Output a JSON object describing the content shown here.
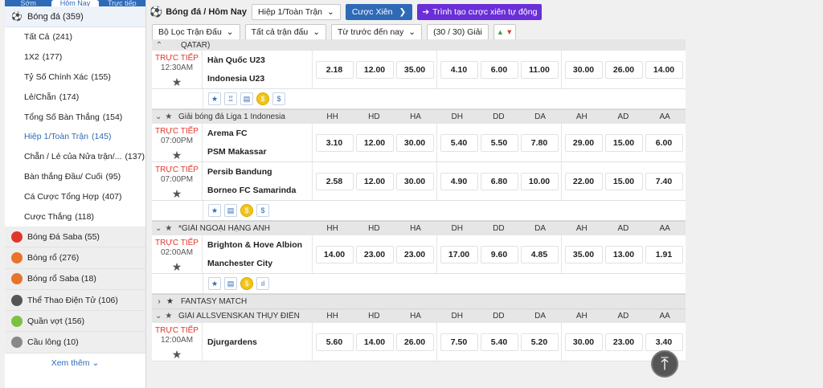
{
  "sidebar": {
    "tabs": [
      "Sớm",
      "Hôm Nay",
      "Trực tiếp"
    ],
    "football": {
      "label": "Bóng đá",
      "count": "(359)"
    },
    "items": [
      {
        "label": "Tất Cả",
        "count": "(241)"
      },
      {
        "label": "1X2",
        "count": "(177)"
      },
      {
        "label": "Tỷ Số Chính Xác",
        "count": "(155)"
      },
      {
        "label": "Lẻ/Chẵn",
        "count": "(174)"
      },
      {
        "label": "Tổng Số Bàn Thắng",
        "count": "(154)"
      },
      {
        "label": "Hiệp 1/Toàn Trận",
        "count": "(145)"
      },
      {
        "label": "Chẵn / Lẻ của Nửa trận/...",
        "count": "(137)"
      },
      {
        "label": "Bàn thắng Đầu/ Cuối",
        "count": "(95)"
      },
      {
        "label": "Cá Cược Tổng Hợp",
        "count": "(407)"
      },
      {
        "label": "Cược Thắng",
        "count": "(118)"
      }
    ],
    "sports": [
      {
        "label": "Bóng Đá Saba",
        "count": "(55)",
        "icon": "soccer-ball-icon",
        "color": "#e0352b"
      },
      {
        "label": "Bóng rổ",
        "count": "(276)",
        "icon": "basketball-icon",
        "color": "#e8732a"
      },
      {
        "label": "Bóng rổ Saba",
        "count": "(18)",
        "icon": "basketball-icon",
        "color": "#e8732a"
      },
      {
        "label": "Thể Thao Điện Tử",
        "count": "(106)",
        "icon": "headset-icon",
        "color": "#555555"
      },
      {
        "label": "Quần vợt",
        "count": "(156)",
        "icon": "tennis-ball-icon",
        "color": "#7cc242"
      },
      {
        "label": "Cầu lông",
        "count": "(10)",
        "icon": "shuttlecock-icon",
        "color": "#888888"
      }
    ],
    "more": "Xem thêm"
  },
  "topbar": {
    "title": "Bóng đá / Hôm Nay",
    "period": "Hiệp 1/Toàn Trận",
    "parlay": "Cược Xiên",
    "auto_builder": "Trình tạo cược xiên tự động"
  },
  "filters": {
    "league_filter": "Bộ Lọc Trận Đấu",
    "all_matches": "Tất cả trận đấu",
    "sort": "Từ trước đến nay",
    "leagues": "(30 / 30) Giải"
  },
  "columns": [
    "HH",
    "HD",
    "HA",
    "DH",
    "DD",
    "DA",
    "AH",
    "AD",
    "AA"
  ],
  "first_league": "QATAR)",
  "leagues": [
    {
      "name": "",
      "matches": [
        {
          "status": "TRỰC TIẾP",
          "time": "12:30AM",
          "home": "Hàn Quốc U23",
          "away": "Indonesia U23",
          "odds": [
            "2.18",
            "12.00",
            "35.00",
            "4.10",
            "6.00",
            "11.00",
            "30.00",
            "26.00",
            "14.00"
          ]
        }
      ]
    },
    {
      "name": "Giải bóng đá Liga 1 Indonesia",
      "matches": [
        {
          "status": "TRỰC TIẾP",
          "time": "07:00PM",
          "home": "Arema FC",
          "away": "PSM Makassar",
          "odds": [
            "3.10",
            "12.00",
            "30.00",
            "5.40",
            "5.50",
            "7.80",
            "29.00",
            "15.00",
            "6.00"
          ]
        },
        {
          "status": "TRỰC TIẾP",
          "time": "07:00PM",
          "home": "Persib Bandung",
          "away": "Borneo FC Samarinda",
          "odds": [
            "2.58",
            "12.00",
            "30.00",
            "4.90",
            "6.80",
            "10.00",
            "22.00",
            "15.00",
            "7.40"
          ]
        }
      ]
    },
    {
      "name": "*GIẢI NGOẠI HẠNG ANH",
      "matches": [
        {
          "status": "TRỰC TIẾP",
          "time": "02:00AM",
          "home": "Brighton & Hove Albion",
          "away": "Manchester City",
          "odds": [
            "14.00",
            "23.00",
            "23.00",
            "17.00",
            "9.60",
            "4.85",
            "35.00",
            "13.00",
            "1.91"
          ]
        }
      ]
    }
  ],
  "fantasy": "FANTASY MATCH",
  "last_league": {
    "name": "GIẢI ALLSVENSKAN THỤY ĐIỂN",
    "match": {
      "status": "TRỰC TIẾP",
      "time": "12:00AM",
      "home": "Djurgardens",
      "odds": [
        "5.60",
        "14.00",
        "26.00",
        "7.50",
        "5.40",
        "5.20",
        "30.00",
        "23.00",
        "3.40"
      ]
    }
  }
}
